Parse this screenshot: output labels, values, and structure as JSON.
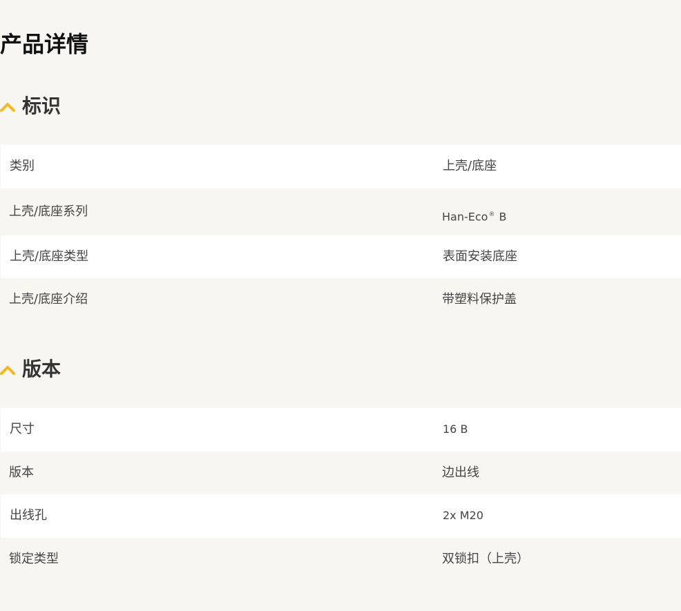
{
  "page": {
    "title": "产品详情"
  },
  "colors": {
    "accent": "#f6b91a",
    "background": "#f7f6f3",
    "row_white": "#ffffff",
    "text": "#444444"
  },
  "sections": [
    {
      "title": "标识",
      "icon": "chevron-up-icon",
      "rows": [
        {
          "label": "类别",
          "value": "上壳/底座"
        },
        {
          "label": "上壳/底座系列",
          "value_prefix": "Han-Eco",
          "value_mark": "®",
          "value_suffix": " B"
        },
        {
          "label": "上壳/底座类型",
          "value": "表面安装底座"
        },
        {
          "label": "上壳/底座介绍",
          "value": "带塑料保护盖"
        }
      ]
    },
    {
      "title": "版本",
      "icon": "chevron-up-icon",
      "rows": [
        {
          "label": "尺寸",
          "value": "16 B"
        },
        {
          "label": "版本",
          "value": "边出线"
        },
        {
          "label": "出线孔",
          "value": "2x M20"
        },
        {
          "label": "锁定类型",
          "value": "双锁扣（上壳）"
        }
      ]
    }
  ]
}
